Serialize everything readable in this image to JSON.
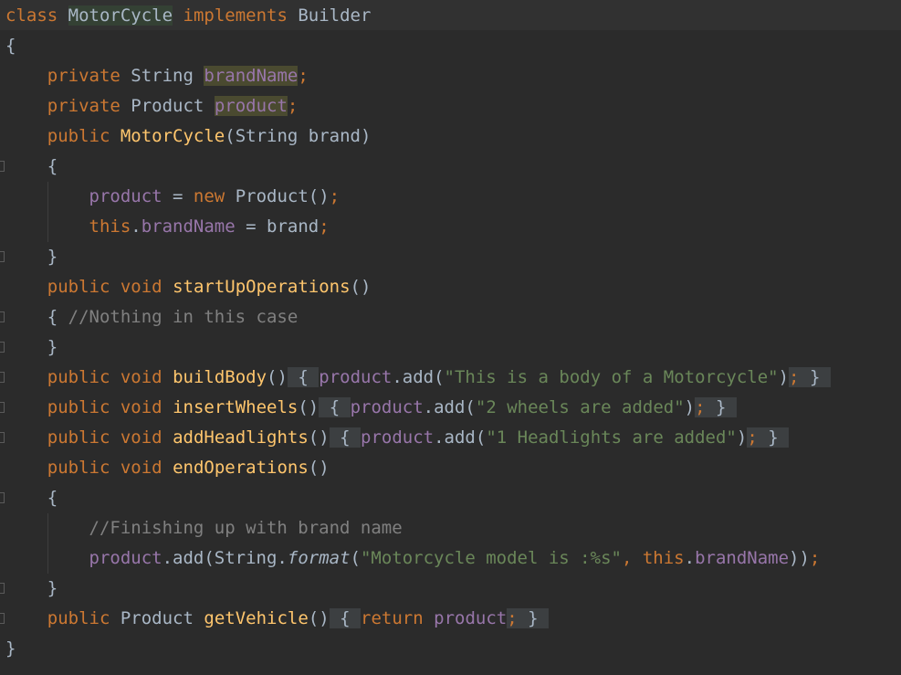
{
  "code": {
    "l1": {
      "kw_class": "class",
      "class_name": "MotorCycle",
      "kw_implements": "implements",
      "iface": "Builder"
    },
    "l2": {
      "brace": "{"
    },
    "l3": {
      "kw": "private",
      "type": "String",
      "field": "brandName",
      "semi": ";"
    },
    "l4": {
      "kw": "private",
      "type": "Product",
      "field": "product",
      "semi": ";"
    },
    "l5": {
      "kw": "public",
      "ctor": "MotorCycle",
      "params": "(String brand)"
    },
    "l6": {
      "brace": "{"
    },
    "l7": {
      "field": "product",
      "op": " = ",
      "kw_new": "new",
      "rest": " Product()",
      "semi": ";"
    },
    "l8": {
      "kw_this": "this",
      "dot": ".",
      "field": "brandName",
      "rest": " = brand",
      "semi": ";"
    },
    "l9": {
      "brace": "}"
    },
    "l10": {
      "kw": "public void",
      "method": "startUpOperations",
      "parens": "()"
    },
    "l11": {
      "brace": "{ ",
      "comment": "//Nothing in this case"
    },
    "l12": {
      "brace": "}"
    },
    "l13": {
      "kw": "public void",
      "method": "buildBody",
      "parens": "()",
      "open": "{",
      "field": "product",
      "call": ".add(",
      "str": "\"This is a body of a Motorcycle\"",
      "close_paren": ")",
      "semi": ";",
      "close": "}"
    },
    "l14": {
      "kw": "public void",
      "method": "insertWheels",
      "parens": "()",
      "open": "{",
      "field": "product",
      "call": ".add(",
      "str": "\"2 wheels are added\"",
      "close_paren": ")",
      "semi": ";",
      "close": "}"
    },
    "l15": {
      "kw": "public void",
      "method": "addHeadlights",
      "parens": "()",
      "open": "{",
      "field": "product",
      "call": ".add(",
      "str": "\"1 Headlights are added\"",
      "close_paren": ")",
      "semi": ";",
      "close": "}"
    },
    "l16": {
      "kw": "public void",
      "method": "endOperations",
      "parens": "()"
    },
    "l17": {
      "brace": "{"
    },
    "l18": {
      "comment": "//Finishing up with brand name"
    },
    "l19": {
      "field": "product",
      "call": ".add(String.",
      "fmt": "format",
      "open_paren": "(",
      "str": "\"Motorcycle model is :%s\"",
      "comma": ", ",
      "kw_this": "this",
      "dot": ".",
      "field2": "brandName",
      "close": "))",
      "semi": ";"
    },
    "l20": {
      "brace": "}"
    },
    "l21": {
      "kw": "public",
      "type": "Product",
      "method": "getVehicle",
      "parens": "()",
      "open": "{",
      "kw_return": "return",
      "field": "product",
      "semi": ";",
      "close": "}"
    },
    "l22": {
      "brace": "}"
    }
  },
  "colors": {
    "background": "#2b2b2b",
    "keyword": "#cc7832",
    "method": "#ffc66d",
    "field": "#9876aa",
    "string": "#6a8759",
    "comment": "#808080",
    "text": "#a9b7c6"
  }
}
